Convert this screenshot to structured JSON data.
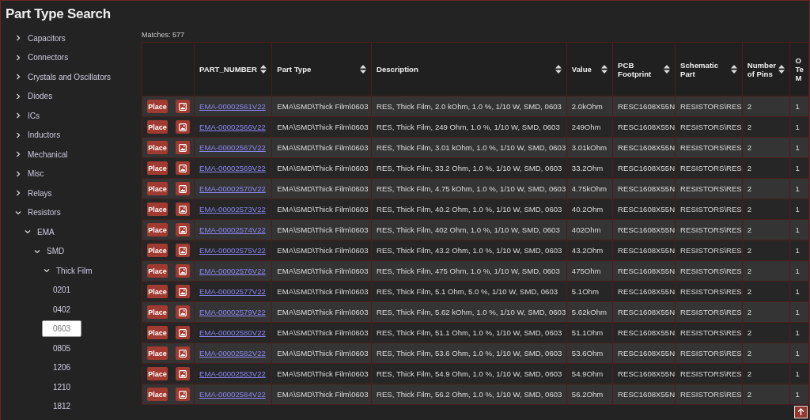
{
  "window": {
    "title": "Part Type Search"
  },
  "tree": [
    {
      "label": "Capacitors",
      "expanded": false,
      "selected": false
    },
    {
      "label": "Connectors",
      "expanded": false,
      "selected": false
    },
    {
      "label": "Crystals and Oscillators",
      "expanded": false,
      "selected": false
    },
    {
      "label": "Diodes",
      "expanded": false,
      "selected": false
    },
    {
      "label": "ICs",
      "expanded": false,
      "selected": false
    },
    {
      "label": "Inductors",
      "expanded": false,
      "selected": false
    },
    {
      "label": "Mechanical",
      "expanded": false,
      "selected": false
    },
    {
      "label": "Misc",
      "expanded": false,
      "selected": false
    },
    {
      "label": "Relays",
      "expanded": false,
      "selected": false
    },
    {
      "label": "Resistors",
      "expanded": true,
      "selected": false,
      "children": [
        {
          "label": "EMA",
          "expanded": true,
          "selected": false,
          "children": [
            {
              "label": "SMD",
              "expanded": true,
              "selected": false,
              "children": [
                {
                  "label": "Thick Film",
                  "expanded": true,
                  "selected": false,
                  "children": [
                    {
                      "label": "0201",
                      "selected": false
                    },
                    {
                      "label": "0402",
                      "selected": false
                    },
                    {
                      "label": "0603",
                      "selected": true
                    },
                    {
                      "label": "0805",
                      "selected": false
                    },
                    {
                      "label": "1206",
                      "selected": false
                    },
                    {
                      "label": "1210",
                      "selected": false
                    },
                    {
                      "label": "1812",
                      "selected": false
                    }
                  ]
                }
              ]
            }
          ]
        }
      ]
    }
  ],
  "matches": "Matches: 577",
  "table": {
    "columns": [
      {
        "sortable": false
      },
      {
        "label": "PART_NUMBER",
        "sortable": true
      },
      {
        "label": "Part Type",
        "sortable": true
      },
      {
        "label": "Description",
        "sortable": true
      },
      {
        "label": "Value",
        "sortable": true
      },
      {
        "label": "PCB Footprint",
        "sortable": true
      },
      {
        "label": "Schematic Part",
        "sortable": true
      },
      {
        "label": "Number of Pins",
        "sortable": true
      },
      {
        "label": "O Te M",
        "sortable": false
      }
    ],
    "rows": [
      {
        "place": "Place",
        "part_number": "EMA-00002561V22",
        "part_type": "EMA\\SMD\\Thick Film\\0603",
        "description": "RES, Thick Film, 2.0 kOhm, 1.0 %, 1/10 W, SMD, 0603",
        "value": "2.0kOhm",
        "footprint": "RESC1608X55N",
        "schematic": "RESISTORS\\RES",
        "pins": "2",
        "column_9": "1"
      },
      {
        "place": "Place",
        "part_number": "EMA-00002566V22",
        "part_type": "EMA\\SMD\\Thick Film\\0603",
        "description": "RES, Thick Film, 249 Ohm, 1.0 %, 1/10 W, SMD, 0603",
        "value": "249Ohm",
        "footprint": "RESC1608X55N",
        "schematic": "RESISTORS\\RES",
        "pins": "2",
        "column_9": "1"
      },
      {
        "place": "Place",
        "part_number": "EMA-00002567V22",
        "part_type": "EMA\\SMD\\Thick Film\\0603",
        "description": "RES, Thick Film, 3.01 kOhm, 1.0 %, 1/10 W, SMD, 0603",
        "value": "3.01kOhm",
        "footprint": "RESC1608X55N",
        "schematic": "RESISTORS\\RES",
        "pins": "2",
        "column_9": "1"
      },
      {
        "place": "Place",
        "part_number": "EMA-00002569V22",
        "part_type": "EMA\\SMD\\Thick Film\\0603",
        "description": "RES, Thick Film, 33.2 Ohm, 1.0 %, 1/10 W, SMD, 0603",
        "value": "33.2Ohm",
        "footprint": "RESC1608X55N",
        "schematic": "RESISTORS\\RES",
        "pins": "2",
        "column_9": "1"
      },
      {
        "place": "Place",
        "part_number": "EMA-00002570V22",
        "part_type": "EMA\\SMD\\Thick Film\\0603",
        "description": "RES, Thick Film, 4.75 kOhm, 1.0 %, 1/10 W, SMD, 0603",
        "value": "4.75kOhm",
        "footprint": "RESC1608X55N",
        "schematic": "RESISTORS\\RES",
        "pins": "2",
        "column_9": "1"
      },
      {
        "place": "Place",
        "part_number": "EMA-00002573V22",
        "part_type": "EMA\\SMD\\Thick Film\\0603",
        "description": "RES, Thick Film, 40.2 Ohm, 1.0 %, 1/10 W, SMD, 0603",
        "value": "40.2Ohm",
        "footprint": "RESC1608X55N",
        "schematic": "RESISTORS\\RES",
        "pins": "2",
        "column_9": "1"
      },
      {
        "place": "Place",
        "part_number": "EMA-00002574V22",
        "part_type": "EMA\\SMD\\Thick Film\\0603",
        "description": "RES, Thick Film, 402 Ohm, 1.0 %, 1/10 W, SMD, 0603",
        "value": "402Ohm",
        "footprint": "RESC1608X55N",
        "schematic": "RESISTORS\\RES",
        "pins": "2",
        "column_9": "1"
      },
      {
        "place": "Place",
        "part_number": "EMA-00002575V22",
        "part_type": "EMA\\SMD\\Thick Film\\0603",
        "description": "RES, Thick Film, 43.2 Ohm, 1.0 %, 1/10 W, SMD, 0603",
        "value": "43.2Ohm",
        "footprint": "RESC1608X55N",
        "schematic": "RESISTORS\\RES",
        "pins": "2",
        "column_9": "1"
      },
      {
        "place": "Place",
        "part_number": "EMA-00002576V22",
        "part_type": "EMA\\SMD\\Thick Film\\0603",
        "description": "RES, Thick Film, 475 Ohm, 1.0 %, 1/10 W, SMD, 0603",
        "value": "475Ohm",
        "footprint": "RESC1608X55N",
        "schematic": "RESISTORS\\RES",
        "pins": "2",
        "column_9": "1"
      },
      {
        "place": "Place",
        "part_number": "EMA-00002577V22",
        "part_type": "EMA\\SMD\\Thick Film\\0603",
        "description": "RES, Thick Film, 5.1 Ohm, 5.0 %, 1/10 W, SMD, 0603",
        "value": "5.1Ohm",
        "footprint": "RESC1608X55N",
        "schematic": "RESISTORS\\RES",
        "pins": "2",
        "column_9": "1"
      },
      {
        "place": "Place",
        "part_number": "EMA-00002579V22",
        "part_type": "EMA\\SMD\\Thick Film\\0603",
        "description": "RES, Thick Film, 5.62 kOhm, 1.0 %, 1/10 W, SMD, 0603",
        "value": "5.62kOhm",
        "footprint": "RESC1608X55N",
        "schematic": "RESISTORS\\RES",
        "pins": "2",
        "column_9": "1"
      },
      {
        "place": "Place",
        "part_number": "EMA-00002580V22",
        "part_type": "EMA\\SMD\\Thick Film\\0603",
        "description": "RES, Thick Film, 51.1 Ohm, 1.0 %, 1/10 W, SMD, 0603",
        "value": "51.1Ohm",
        "footprint": "RESC1608X55N",
        "schematic": "RESISTORS\\RES",
        "pins": "2",
        "column_9": "1"
      },
      {
        "place": "Place",
        "part_number": "EMA-00002582V22",
        "part_type": "EMA\\SMD\\Thick Film\\0603",
        "description": "RES, Thick Film, 53.6 Ohm, 1.0 %, 1/10 W, SMD, 0603",
        "value": "53.6Ohm",
        "footprint": "RESC1608X55N",
        "schematic": "RESISTORS\\RES",
        "pins": "2",
        "column_9": "1"
      },
      {
        "place": "Place",
        "part_number": "EMA-00002583V22",
        "part_type": "EMA\\SMD\\Thick Film\\0603",
        "description": "RES, Thick Film, 54.9 Ohm, 1.0 %, 1/10 W, SMD, 0603",
        "value": "54.9Ohm",
        "footprint": "RESC1608X55N",
        "schematic": "RESISTORS\\RES",
        "pins": "2",
        "column_9": "1"
      },
      {
        "place": "Place",
        "part_number": "EMA-00002584V22",
        "part_type": "EMA\\SMD\\Thick Film\\0603",
        "description": "RES, Thick Film, 56.2 Ohm, 1.0 %, 1/10 W, SMD, 0603",
        "value": "56.2Ohm",
        "footprint": "RESC1608X55N",
        "schematic": "RESISTORS\\RES",
        "pins": "2",
        "column_9": "1"
      }
    ]
  }
}
